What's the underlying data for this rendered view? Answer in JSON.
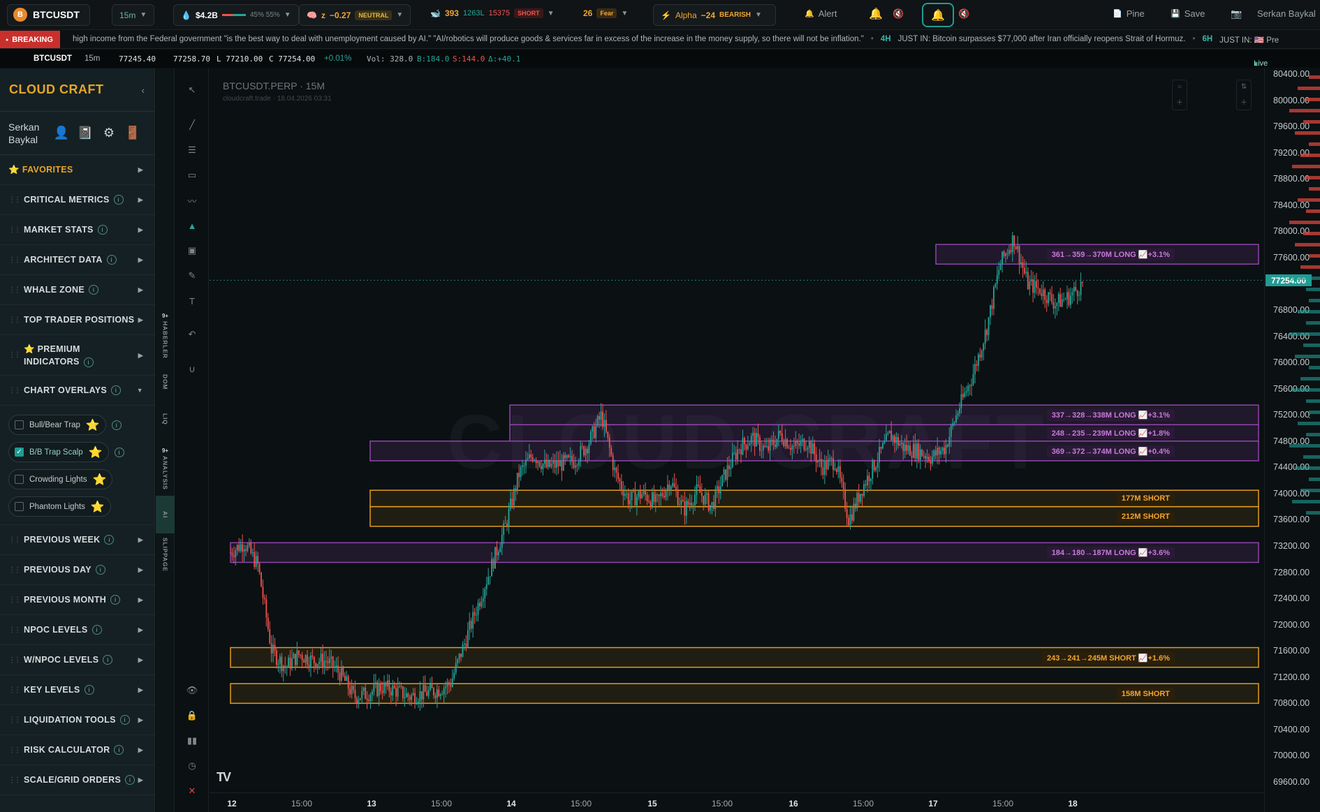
{
  "topbar": {
    "symbol": "BTCUSDT",
    "coin_letter": "B",
    "interval": "15m",
    "liquidity": "$4.2B",
    "liquidity_split": "45% 55%",
    "z_label": "z",
    "z_value": "−0.27",
    "z_tag": "NEUTRAL",
    "whale_count": "393",
    "whale_long": "1263L",
    "whale_short_count": "15375",
    "whale_tag": "SHORT",
    "fear_value": "26",
    "fear_tag": "Fear",
    "alpha_label": "Alpha",
    "alpha_value": "−24",
    "alpha_tag": "BEARISH",
    "alert_label": "Alert",
    "pine_label": "Pine",
    "save_label": "Save",
    "user_label": "Serkan Baykal"
  },
  "ticker": {
    "badge": "BREAKING",
    "items": [
      {
        "tf": "",
        "text": "high income from the Federal government \"is the best way to deal with unemployment caused by AI.\" \"AI/robotics will produce goods & services far in excess of the increase in the money supply, so there will not be inflation.\""
      },
      {
        "tf": "4H",
        "text": "JUST IN: Bitcoin surpasses $77,000 after Iran officially reopens Strait of Hormuz."
      },
      {
        "tf": "6H",
        "text": "JUST IN: 🇺🇸 Pre"
      }
    ]
  },
  "ohlc": {
    "symbol": "BTCUSDT",
    "interval": "15m",
    "last": "77245.40",
    "open": "77258.70",
    "low": "L 77210.00",
    "close": "C 77254.00",
    "change": "+0.01%",
    "vol": "Vol: 328.0",
    "buy": "B:184.0",
    "sell": "S:144.0",
    "delta": "Δ:+40.1",
    "live": "Live"
  },
  "sidebar": {
    "brand": "CLOUD CRAFT",
    "user_name": "Serkan Baykal",
    "sections": [
      {
        "label": "FAVORITES",
        "info": false
      },
      {
        "label": "CRITICAL METRICS",
        "info": true
      },
      {
        "label": "MARKET STATS",
        "info": true
      },
      {
        "label": "ARCHITECT DATA",
        "info": true
      },
      {
        "label": "WHALE ZONE",
        "info": true
      },
      {
        "label": "TOP TRADER POSITIONS",
        "info": false
      },
      {
        "label": "PREMIUM INDICATORS",
        "info": true
      },
      {
        "label": "CHART OVERLAYS",
        "info": true
      }
    ],
    "overlays": [
      {
        "label": "Bull/Bear Trap",
        "checked": false
      },
      {
        "label": "B/B Trap Scalp",
        "checked": true
      },
      {
        "label": "Crowding Lights",
        "checked": false
      },
      {
        "label": "Phantom Lights",
        "checked": false
      }
    ],
    "sections_after": [
      {
        "label": "PREVIOUS WEEK"
      },
      {
        "label": "PREVIOUS DAY"
      },
      {
        "label": "PREVIOUS MONTH"
      },
      {
        "label": "NPOC LEVELS"
      },
      {
        "label": "W/NPOC LEVELS"
      },
      {
        "label": "KEY LEVELS"
      },
      {
        "label": "LIQUIDATION TOOLS"
      },
      {
        "label": "RISK CALCULATOR"
      },
      {
        "label": "SCALE/GRID ORDERS"
      }
    ]
  },
  "vtabs": {
    "haberler": "HABERLER",
    "haberler_badge": "9+",
    "dom": "DOM",
    "liq": "LIQ",
    "analysis": "ANALYSIS",
    "analysis_badge": "9+",
    "ai": "AI",
    "slippage": "SLIPPAGE"
  },
  "chart": {
    "title": "BTCUSDT.PERP · 15M",
    "subtitle": "cloudcraft.trade · 18.04.2026 03:31",
    "watermark": "CLOUD CRAFT",
    "current_price": "77254.00",
    "colors": {
      "up": "#26a69a",
      "down": "#ef5350",
      "long_zone": "#8e44ad",
      "short_zone": "#e39b1d",
      "accent": "#1f9c93"
    }
  },
  "chart_data": {
    "type": "candlestick",
    "ylim": [
      69400,
      80200
    ],
    "y_ticks": [
      "80400.00",
      "80000.00",
      "79600.00",
      "79200.00",
      "78800.00",
      "78400.00",
      "78000.00",
      "77600.00",
      "76800.00",
      "76400.00",
      "76000.00",
      "75600.00",
      "75200.00",
      "74800.00",
      "74400.00",
      "74000.00",
      "73600.00",
      "73200.00",
      "72800.00",
      "72400.00",
      "72000.00",
      "71600.00",
      "71200.00",
      "70800.00",
      "70400.00",
      "70000.00",
      "69600.00"
    ],
    "x_ticks": [
      {
        "label": "12",
        "day": true
      },
      {
        "label": "15:00",
        "day": false
      },
      {
        "label": "13",
        "day": true
      },
      {
        "label": "15:00",
        "day": false
      },
      {
        "label": "14",
        "day": true
      },
      {
        "label": "15:00",
        "day": false
      },
      {
        "label": "15",
        "day": true
      },
      {
        "label": "15:00",
        "day": false
      },
      {
        "label": "16",
        "day": true
      },
      {
        "label": "15:00",
        "day": false
      },
      {
        "label": "17",
        "day": true
      },
      {
        "label": "15:00",
        "day": false
      },
      {
        "label": "18",
        "day": true
      }
    ],
    "last_price": 77254,
    "price_path": [
      [
        0,
        73100
      ],
      [
        2,
        73250
      ],
      [
        4,
        72900
      ],
      [
        6,
        71600
      ],
      [
        8,
        71350
      ],
      [
        10,
        71550
      ],
      [
        12,
        71450
      ],
      [
        14,
        71450
      ],
      [
        16,
        71250
      ],
      [
        18,
        70900
      ],
      [
        20,
        70950
      ],
      [
        22,
        71050
      ],
      [
        24,
        71000
      ],
      [
        26,
        70900
      ],
      [
        28,
        70950
      ],
      [
        30,
        71000
      ],
      [
        32,
        71100
      ],
      [
        34,
        71700
      ],
      [
        36,
        72300
      ],
      [
        38,
        72900
      ],
      [
        40,
        73500
      ],
      [
        42,
        74300
      ],
      [
        44,
        74600
      ],
      [
        46,
        74400
      ],
      [
        48,
        74450
      ],
      [
        50,
        74500
      ],
      [
        52,
        74750
      ],
      [
        54,
        75200
      ],
      [
        56,
        74300
      ],
      [
        58,
        73900
      ],
      [
        60,
        74000
      ],
      [
        62,
        73850
      ],
      [
        64,
        74200
      ],
      [
        66,
        73750
      ],
      [
        68,
        74050
      ],
      [
        70,
        73800
      ],
      [
        72,
        74300
      ],
      [
        74,
        74700
      ],
      [
        76,
        74850
      ],
      [
        78,
        74650
      ],
      [
        80,
        74900
      ],
      [
        82,
        74700
      ],
      [
        84,
        74800
      ],
      [
        86,
        74400
      ],
      [
        88,
        74500
      ],
      [
        90,
        73600
      ],
      [
        92,
        74100
      ],
      [
        94,
        74500
      ],
      [
        96,
        74900
      ],
      [
        98,
        74700
      ],
      [
        100,
        74650
      ],
      [
        102,
        74550
      ],
      [
        104,
        74700
      ],
      [
        106,
        75300
      ],
      [
        108,
        75800
      ],
      [
        110,
        76500
      ],
      [
        112,
        77500
      ],
      [
        114,
        77900
      ],
      [
        116,
        77200
      ],
      [
        118,
        77100
      ],
      [
        120,
        76900
      ],
      [
        122,
        77000
      ],
      [
        124,
        77200
      ]
    ],
    "zones": [
      {
        "side": "long",
        "low": 77500,
        "high": 77800,
        "label": "361→359→370M LONG 📈+3.1%"
      },
      {
        "side": "long",
        "low": 75050,
        "high": 75350,
        "label": "337→328→338M LONG 📈+3.1%"
      },
      {
        "side": "long",
        "low": 74800,
        "high": 75050,
        "label": "248→235→239M LONG 📈+1.8%"
      },
      {
        "side": "long",
        "low": 74500,
        "high": 74800,
        "label": "369→372→374M LONG 📈+0.4%"
      },
      {
        "side": "short",
        "low": 73800,
        "high": 74050,
        "label": "177M SHORT"
      },
      {
        "side": "short",
        "low": 73500,
        "high": 73800,
        "label": "212M SHORT"
      },
      {
        "side": "long",
        "low": 72950,
        "high": 73250,
        "label": "184→180→187M LONG 📈+3.6%"
      },
      {
        "side": "short",
        "low": 71350,
        "high": 71650,
        "label": "243→241→245M SHORT 📈+1.6%"
      },
      {
        "side": "short",
        "low": 70800,
        "high": 71100,
        "label": "158M SHORT"
      }
    ]
  }
}
